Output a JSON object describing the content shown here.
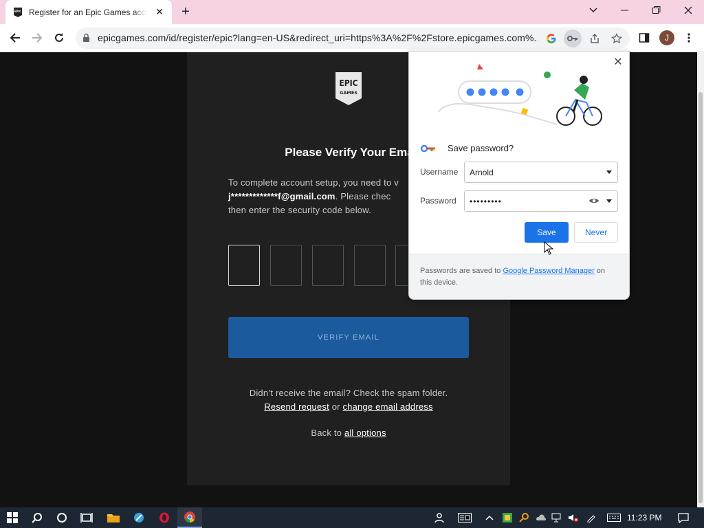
{
  "browser": {
    "tab_title": "Register for an Epic Games account",
    "url": "epicgames.com/id/register/epic?lang=en-US&redirect_uri=https%3A%2F%2Fstore.epicgames.com%...",
    "profile_initial": "J"
  },
  "page": {
    "logo_text_top": "EPIC",
    "logo_text_bottom": "GAMES",
    "heading": "Please Verify Your Ema",
    "desc_line1": "To complete account setup, you need to v",
    "masked_email": "j*************f@gmail.com",
    "desc_line2_rest": ". Please chec",
    "desc_line3": "then enter the security code below.",
    "verify_button": "VERIFY EMAIL",
    "resend_text": "Didn’t receive the email? Check the spam folder.",
    "resend_link": "Resend request",
    "or_text": " or ",
    "change_email_link": "change email address",
    "back_text": "Back to ",
    "all_options_link": "all options"
  },
  "password_popup": {
    "title": "Save password?",
    "username_label": "Username",
    "username_value": "Arnold",
    "password_label": "Password",
    "password_value": "•••••••••",
    "save_button": "Save",
    "never_button": "Never",
    "footer_prefix": "Passwords are saved to ",
    "footer_link": "Google Password Manager",
    "footer_suffix": " on this device."
  },
  "taskbar": {
    "clock": "11:23 PM"
  }
}
